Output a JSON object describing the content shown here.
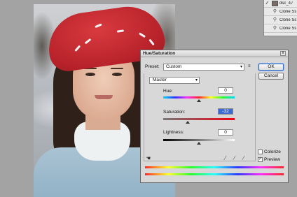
{
  "layers": [
    {
      "visible": true,
      "kind": "image",
      "name": "dsc_47"
    },
    {
      "visible": false,
      "kind": "clone",
      "name": "Clone Ss"
    },
    {
      "visible": false,
      "kind": "clone",
      "name": "Clone Ss"
    },
    {
      "visible": false,
      "kind": "clone",
      "name": "Clone Ss"
    }
  ],
  "layer_icons": {
    "eye": "eye-icon",
    "check": "✓",
    "stamp": "⚲"
  },
  "dialog": {
    "title": "Hue/Saturation",
    "close_label": "x",
    "preset_label": "Preset:",
    "preset_value": "Custom",
    "preset_arrow": "▾",
    "preset_menu": "≡",
    "ok_label": "OK",
    "cancel_label": "Cancel",
    "channel_value": "Master",
    "channel_arrow": "▾",
    "hue_label": "Hue:",
    "hue_value": "0",
    "saturation_label": "Saturation:",
    "saturation_value": "-32",
    "lightness_label": "Lightness:",
    "lightness_value": "0",
    "colorize_label": "Colorize",
    "colorize_checked": false,
    "preview_label": "Preview",
    "preview_checked": true,
    "check_mark": "✓",
    "hand_icon": "☚",
    "eyedropper_glyph": "⁄"
  },
  "sliders": {
    "hue_fraction": 0.5,
    "saturation_fraction": 0.34,
    "lightness_fraction": 0.5
  },
  "colors": {
    "dialog_bg": "#d8d8d8",
    "selected_input": "#3b6bd4",
    "beret_red": "#c42a31"
  }
}
